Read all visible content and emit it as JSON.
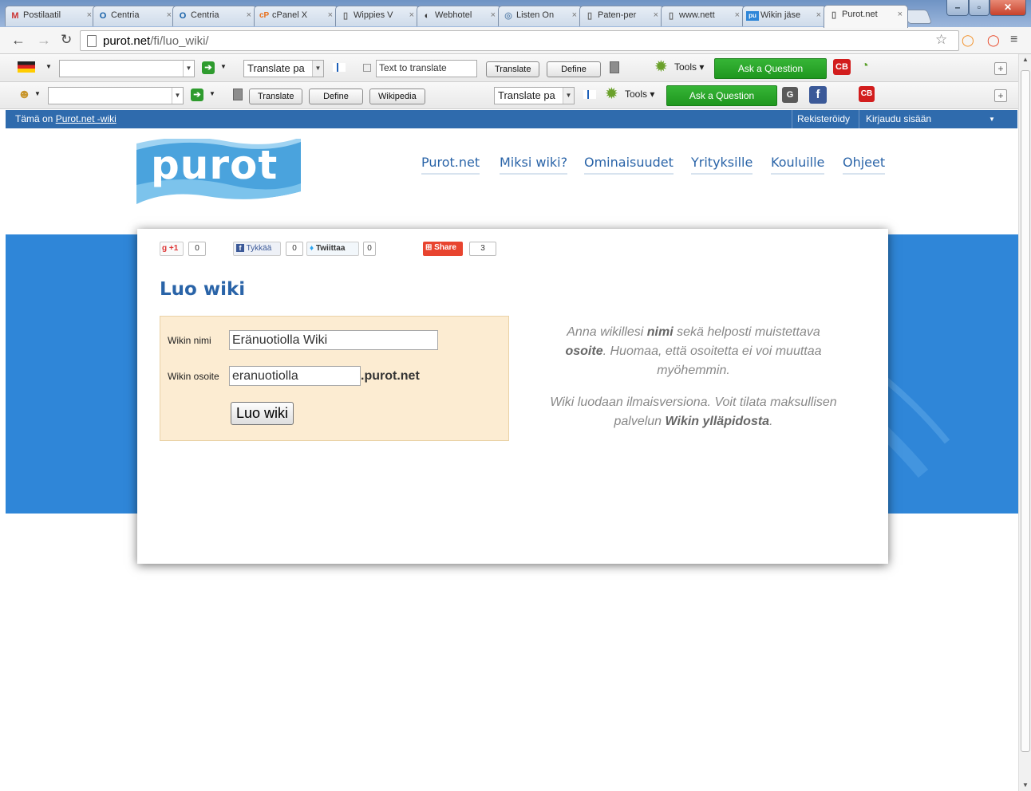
{
  "browser": {
    "tabs": [
      {
        "label": "Postilaatil",
        "icon": "gmail-icon"
      },
      {
        "label": "Centria",
        "icon": "outlook-icon"
      },
      {
        "label": "Centria",
        "icon": "outlook-icon"
      },
      {
        "label": "cPanel X",
        "icon": "cpanel-icon"
      },
      {
        "label": "Wippies V",
        "icon": "page-icon"
      },
      {
        "label": "Webhotel",
        "icon": "webhotel-icon"
      },
      {
        "label": "Listen On",
        "icon": "globe-icon"
      },
      {
        "label": "Paten-per",
        "icon": "page-icon"
      },
      {
        "label": "www.nett",
        "icon": "page-icon"
      },
      {
        "label": "Wikin jäse",
        "icon": "purot-icon"
      },
      {
        "label": "Purot.net",
        "icon": "page-icon"
      }
    ],
    "url_host": "purot.net",
    "url_path": "/fi/luo_wiki/"
  },
  "toolbar1": {
    "translate_select": "Translate pa",
    "text_placeholder": "Text to translate",
    "translate_label": "Translate",
    "define_label": "Define",
    "tools_label": "Tools",
    "ask_label": "Ask a Question",
    "cb_label": "CB"
  },
  "toolbar2": {
    "translate_label": "Translate",
    "define_label": "Define",
    "wikipedia_label": "Wikipedia",
    "translate_select": "Translate pa",
    "tools_label": "Tools",
    "ask_label": "Ask a Question",
    "g_label": "G",
    "fb_label": "f",
    "cb_label": "CB"
  },
  "wikibar": {
    "prefix": "Tämä on",
    "link": "Purot.net -wiki",
    "register": "Rekisteröidy",
    "login": "Kirjaudu sisään"
  },
  "site": {
    "logo_text": "purot",
    "nav": [
      "Purot.net",
      "Miksi wiki?",
      "Ominaisuudet",
      "Yrityksille",
      "Kouluille",
      "Ohjeet"
    ]
  },
  "social": {
    "gplus_label": "+1",
    "gplus_count": "0",
    "fb_label": "Tykkää",
    "fb_count": "0",
    "tw_label": "Twiittaa",
    "tw_count": "0",
    "share_label": "Share",
    "share_count": "3"
  },
  "form": {
    "title": "Luo wiki",
    "name_label": "Wikin nimi",
    "name_value": "Eränuotiolla Wiki",
    "address_label": "Wikin osoite",
    "address_value": "eranuotiolla",
    "domain_suffix": ".purot.net",
    "submit_label": "Luo wiki"
  },
  "help": {
    "p1_a": "Anna wikillesi",
    "p1_b": "nimi",
    "p1_c": "sekä helposti muistettava",
    "p1_d": "osoite",
    "p1_e": ". Huomaa, että osoitetta ei voi muuttaa myöhemmin.",
    "p2_a": "Wiki luodaan ilmaisversiona. Voit tilata maksullisen palvelun",
    "p2_b": "Wikin ylläpidosta",
    "p2_c": "."
  },
  "colors": {
    "brand_blue": "#2f86d8",
    "wikibar_blue": "#2f6bad",
    "link_blue": "#2a64a8",
    "form_bg": "#fcecd2",
    "ask_green": "#1f971f"
  }
}
